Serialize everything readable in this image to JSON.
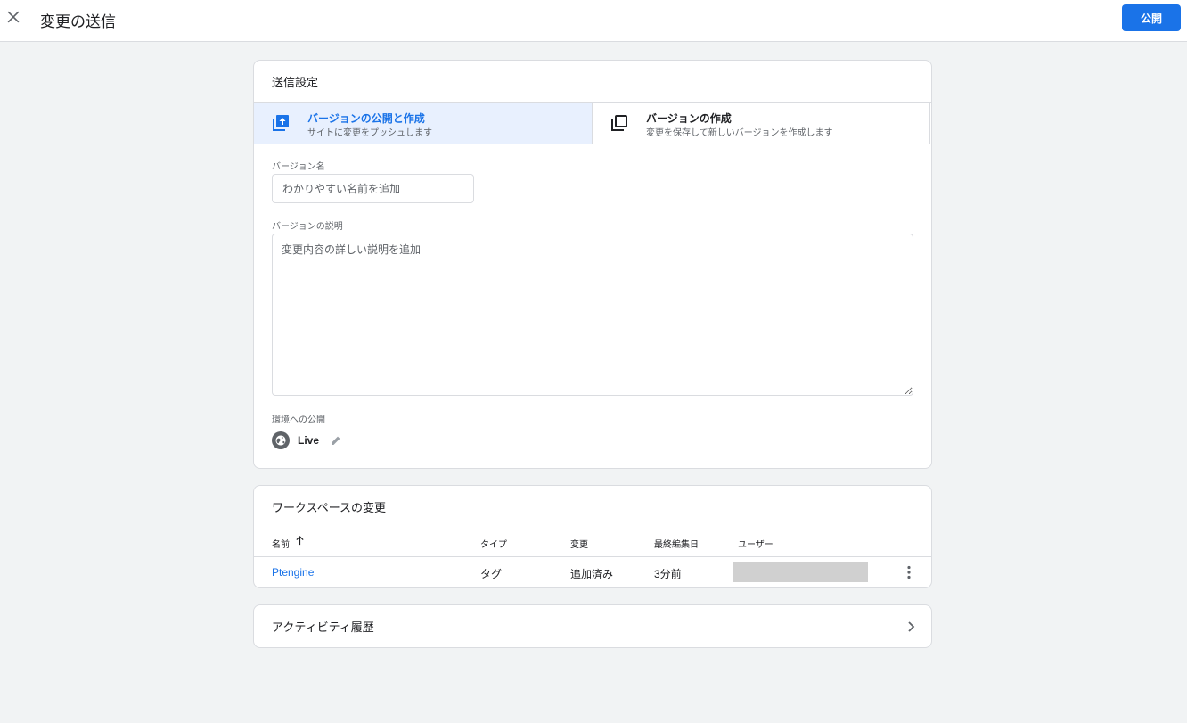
{
  "header": {
    "title": "変更の送信",
    "publish_label": "公開"
  },
  "settings": {
    "title": "送信設定",
    "options": [
      {
        "title": "バージョンの公開と作成",
        "subtitle": "サイトに変更をプッシュします",
        "selected": true,
        "icon": "publish-upload-icon"
      },
      {
        "title": "バージョンの作成",
        "subtitle": "変更を保存して新しいバージョンを作成します",
        "selected": false,
        "icon": "copy-version-icon"
      }
    ],
    "version_name_label": "バージョン名",
    "version_name_placeholder": "わかりやすい名前を追加",
    "version_name_value": "",
    "version_desc_label": "バージョンの説明",
    "version_desc_placeholder": "変更内容の詳しい説明を追加",
    "version_desc_value": "",
    "env_label": "環境への公開",
    "env_name": "Live"
  },
  "workspace": {
    "title": "ワークスペースの変更",
    "columns": [
      "名前",
      "タイプ",
      "変更",
      "最終編集日",
      "ユーザー"
    ],
    "rows": [
      {
        "name": "Ptengine",
        "type": "タグ",
        "change": "追加済み",
        "edited": "3分前",
        "user": ""
      }
    ]
  },
  "activity": {
    "title": "アクティビティ履歴"
  },
  "colors": {
    "accent": "#1a73e8",
    "selected_bg": "#e8f0fe",
    "page_bg": "#f1f3f4"
  }
}
